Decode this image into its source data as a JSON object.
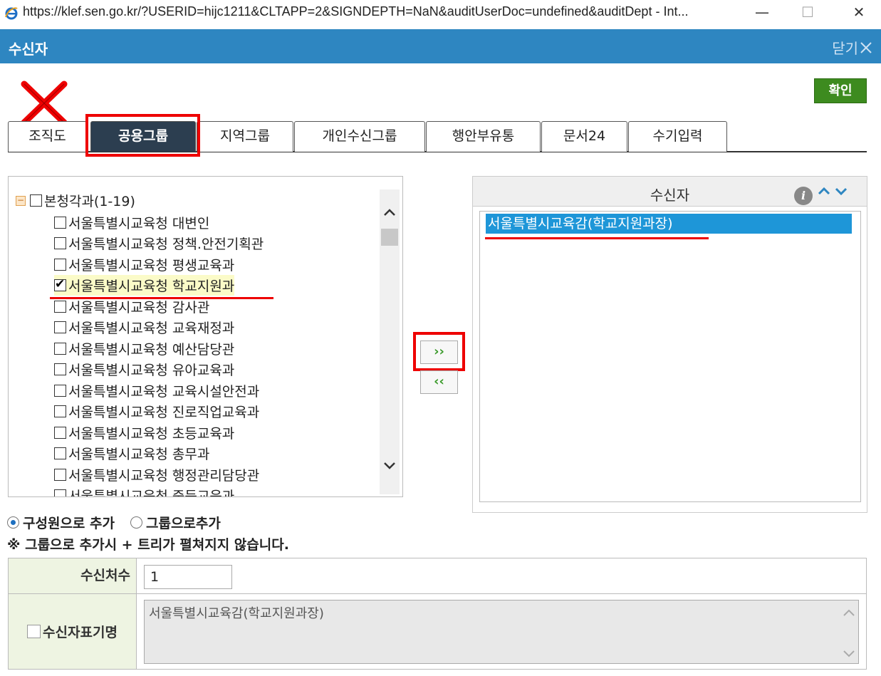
{
  "window": {
    "url_title": "https://klef.sen.go.kr/?USERID=hijc1211&CLTAPP=2&SIGNDEPTH=NaN&auditUserDoc=undefined&auditDept - Int...",
    "minimize": "—",
    "maximize": "☐",
    "close": "✕"
  },
  "dialog": {
    "title": "수신자",
    "close_label": "닫기",
    "confirm_label": "확인"
  },
  "tabs": [
    {
      "label": "조직도"
    },
    {
      "label": "공용그룹"
    },
    {
      "label": "지역그룹"
    },
    {
      "label": "개인수신그룹"
    },
    {
      "label": "행안부유통"
    },
    {
      "label": "문서24"
    },
    {
      "label": "수기입력"
    }
  ],
  "tree": {
    "root_label": "본청각과(1-19)",
    "items": [
      {
        "label": "서울특별시교육청 대변인",
        "checked": false
      },
      {
        "label": "서울특별시교육청 정책.안전기획관",
        "checked": false
      },
      {
        "label": "서울특별시교육청 평생교육과",
        "checked": false
      },
      {
        "label": "서울특별시교육청 학교지원과",
        "checked": true
      },
      {
        "label": "서울특별시교육청 감사관",
        "checked": false
      },
      {
        "label": "서울특별시교육청 교육재정과",
        "checked": false
      },
      {
        "label": "서울특별시교육청 예산담당관",
        "checked": false
      },
      {
        "label": "서울특별시교육청 유아교육과",
        "checked": false
      },
      {
        "label": "서울특별시교육청 교육시설안전과",
        "checked": false
      },
      {
        "label": "서울특별시교육청 진로직업교육과",
        "checked": false
      },
      {
        "label": "서울특별시교육청 초등교육과",
        "checked": false
      },
      {
        "label": "서울특별시교육청 총무과",
        "checked": false
      },
      {
        "label": "서울특별시교육청 행정관리담당관",
        "checked": false
      },
      {
        "label": "서울특별시교육청 중등교육과",
        "checked": false
      }
    ]
  },
  "move": {
    "add_label": "››",
    "remove_label": "‹‹"
  },
  "recipients": {
    "header": "수신자",
    "info_icon": "i",
    "up_icon": "⌃",
    "down_icon": "⌄",
    "items": [
      "서울특별시교육감(학교지원과장)"
    ]
  },
  "options": {
    "radio1": "구성원으로 추가",
    "radio2": "그룹으로추가",
    "note": "※ 그룹으로 추가시 + 트리가 펼쳐지지 않습니다."
  },
  "form": {
    "count_label": "수신처수",
    "count_value": "1",
    "display_label": "수신자표기명",
    "display_value": "서울특별시교육감(학교지원과장)"
  }
}
